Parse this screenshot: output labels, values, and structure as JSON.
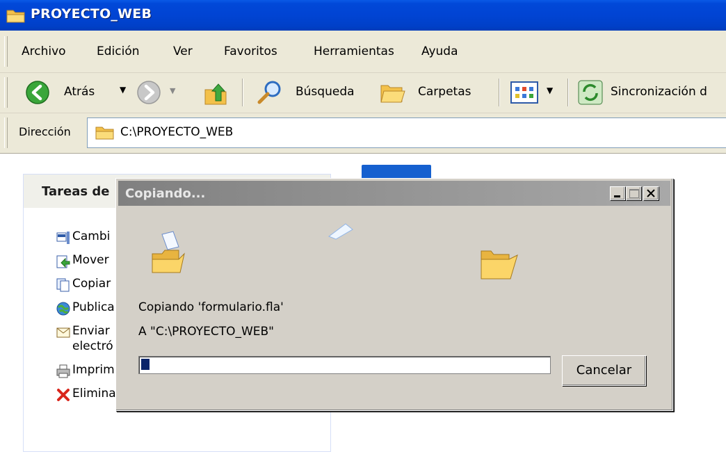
{
  "window": {
    "title": "PROYECTO_WEB"
  },
  "menu": [
    "Archivo",
    "Edición",
    "Ver",
    "Favoritos",
    "Herramientas",
    "Ayuda"
  ],
  "toolbar": {
    "back_label": "Atrás",
    "search_label": "Búsqueda",
    "folders_label": "Carpetas",
    "sync_label": "Sincronización d"
  },
  "address": {
    "label": "Dirección",
    "value": "C:\\PROYECTO_WEB"
  },
  "taskpane": {
    "title": "Tareas de",
    "items": [
      "Cambi",
      "Mover",
      "Copiar",
      "Publica",
      "Enviar",
      "electró",
      "Imprim",
      "Eliminar este archivo"
    ]
  },
  "dialog": {
    "title": "Copiando...",
    "line1": "Copiando 'formulario.fla'",
    "line2": "A \"C:\\PROYECTO_WEB\"",
    "progress": 0.02,
    "cancel_label": "Cancelar"
  }
}
